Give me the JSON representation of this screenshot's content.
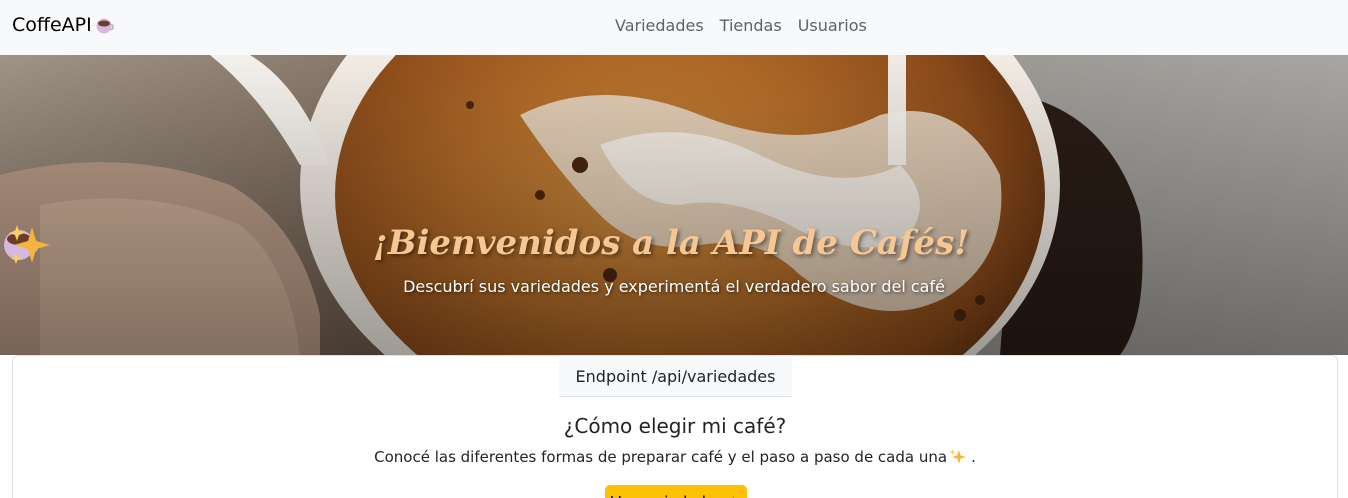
{
  "navbar": {
    "brand": "CoffeAPI",
    "links": [
      "Variedades",
      "Tiendas",
      "Usuarios"
    ]
  },
  "hero": {
    "title": "¡Bienvenidos a la API de Cafés!",
    "subtitle": "Descubrí sus variedades y experimentá el verdadero sabor del café"
  },
  "card": {
    "header": "Endpoint /api/variedades",
    "title": "¿Cómo elegir mi café?",
    "text": "Conocé las diferentes formas de preparar café y el paso a paso de cada una",
    "text_end": ".",
    "button": "Ver variedades ☕"
  },
  "colors": {
    "accent_button": "#ffc107",
    "title_color": "#f7c793",
    "navbar_bg": "#f8f9fa"
  },
  "icons": [
    "coffee-cup-icon",
    "sparkles-icon"
  ]
}
